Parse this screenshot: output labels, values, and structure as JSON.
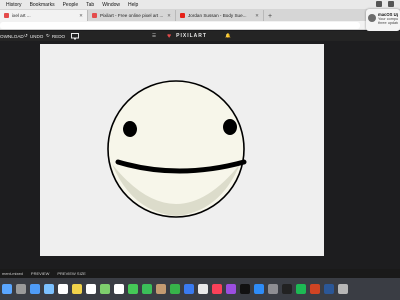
{
  "menubar": {
    "items": [
      "History",
      "Bookmarks",
      "People",
      "Tab",
      "Window",
      "Help"
    ]
  },
  "tabs": [
    {
      "label": "ixel art ...",
      "active": true,
      "color": "#e44b4b"
    },
    {
      "label": "Pixilart - Free online pixel art ...",
      "active": false,
      "color": "#e44b4b"
    },
    {
      "label": "Jordan Sussan - Body Sue...",
      "active": false,
      "color": "#e62117"
    }
  ],
  "notification": {
    "title": "macOS Upda",
    "line1": "Your comput",
    "line2": "three update"
  },
  "toolbar": {
    "download": "OWNLOAD",
    "undo": "UNDO",
    "redo": "REDO",
    "logo": "PIXILART"
  },
  "bottombar": {
    "left": "ment-mixed",
    "preview": "PREVIEW",
    "preview_size": "PREVIEW SIZE"
  },
  "dock": {
    "icons": [
      "finder-icon",
      "launchpad-icon",
      "safari-icon",
      "mail-icon",
      "calendar-icon",
      "notes-icon",
      "reminders-icon",
      "maps-icon",
      "photos-icon",
      "messages-icon",
      "facetime-icon",
      "contacts-icon",
      "numbers-icon",
      "keynote-icon",
      "chrome-icon",
      "music-icon",
      "podcasts-icon",
      "tv-icon",
      "appstore-icon",
      "preferences-icon",
      "activity-icon",
      "spotify-icon",
      "powerpoint-icon",
      "word-icon",
      "trash-icon"
    ]
  },
  "colors": {
    "face": "#f7f6ea",
    "shadow": "#dcdccb",
    "outline": "#000000"
  }
}
